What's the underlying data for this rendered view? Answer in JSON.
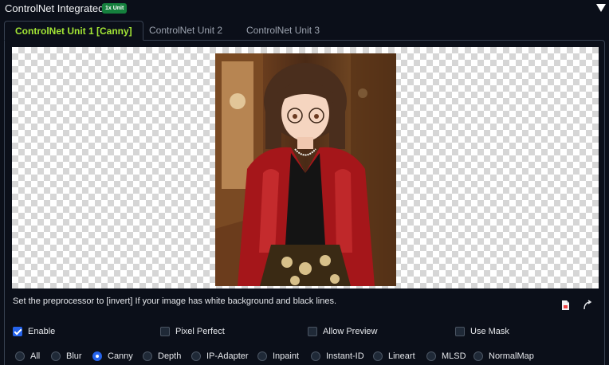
{
  "header": {
    "title": "ControlNet Integrated",
    "badge": "1x Unit",
    "collapse_icon": "triangle-down-icon"
  },
  "tabs": [
    {
      "label": "ControlNet Unit 1 [Canny]",
      "active": true
    },
    {
      "label": "ControlNet Unit 2",
      "active": false
    },
    {
      "label": "ControlNet Unit 3",
      "active": false
    }
  ],
  "image": {
    "icon_actions": [
      "document-icon",
      "rotate-icon"
    ]
  },
  "hint": "Set the preprocessor to [invert] If your image has white background and black lines.",
  "checkboxes": [
    {
      "label": "Enable",
      "checked": true
    },
    {
      "label": "Pixel Perfect",
      "checked": false
    },
    {
      "label": "Allow Preview",
      "checked": false
    },
    {
      "label": "Use Mask",
      "checked": false
    }
  ],
  "control_types": [
    {
      "label": "All",
      "selected": false
    },
    {
      "label": "Blur",
      "selected": false
    },
    {
      "label": "Canny",
      "selected": true
    },
    {
      "label": "Depth",
      "selected": false
    },
    {
      "label": "IP-Adapter",
      "selected": false
    },
    {
      "label": "Inpaint",
      "selected": false
    },
    {
      "label": "Instant-ID",
      "selected": false
    },
    {
      "label": "Lineart",
      "selected": false
    },
    {
      "label": "MLSD",
      "selected": false
    },
    {
      "label": "NormalMap",
      "selected": false
    }
  ],
  "colors": {
    "background": "#0b0f19",
    "active_tab": "#a3e635",
    "badge": "#15803d",
    "accent": "#2563eb"
  }
}
